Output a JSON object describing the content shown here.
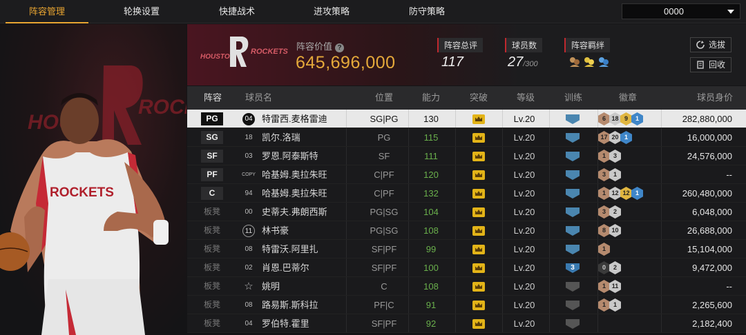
{
  "nav": {
    "tabs": [
      "阵容管理",
      "轮换设置",
      "快捷战术",
      "进攻策略",
      "防守策略"
    ],
    "active_tab": 0,
    "currency_value": "0000"
  },
  "team": {
    "logo_text": "HOUSTON ROCKETS",
    "value_label": "阵容价值",
    "value": "645,696,000",
    "overall_label": "阵容总评",
    "overall": "117",
    "players_label": "球员数",
    "players_count": "27",
    "players_max": "/300",
    "bonds_label": "阵容羁绊",
    "btn_select": "选拔",
    "btn_recycle": "回收"
  },
  "player_art": {
    "jersey_text": "ROCKETS",
    "backdrop_text": "HOUSTON ROCKETS"
  },
  "table": {
    "headers": {
      "slot": "阵容",
      "name": "球员名",
      "position": "位置",
      "ability": "能力",
      "breakthrough": "突破",
      "level": "等级",
      "training": "训练",
      "badges": "徽章",
      "salary": "球员身价"
    },
    "rows": [
      {
        "slot": "PG",
        "starter": true,
        "num": "04",
        "numStyle": "disk",
        "name": "特雷西.麦格雷迪",
        "position": "SG|PG",
        "ability": "130",
        "level": "Lv.20",
        "training": "blue",
        "badges": [
          {
            "t": "b",
            "v": "6"
          },
          {
            "t": "s",
            "v": "18"
          },
          {
            "t": "g",
            "v": "9"
          },
          {
            "t": "h",
            "v": "1"
          }
        ],
        "salary": "282,880,000",
        "selected": true
      },
      {
        "slot": "SG",
        "starter": true,
        "num": "18",
        "numStyle": "",
        "name": "凯尔.洛瑞",
        "position": "PG",
        "ability": "115",
        "level": "Lv.20",
        "training": "blue",
        "badges": [
          {
            "t": "b",
            "v": "17"
          },
          {
            "t": "s",
            "v": "20"
          },
          {
            "t": "h",
            "v": "1"
          }
        ],
        "salary": "16,000,000"
      },
      {
        "slot": "SF",
        "starter": true,
        "num": "03",
        "numStyle": "",
        "name": "罗恩.阿泰斯特",
        "position": "SF",
        "ability": "111",
        "level": "Lv.20",
        "training": "blue",
        "badges": [
          {
            "t": "b",
            "v": "1"
          },
          {
            "t": "s",
            "v": "3"
          }
        ],
        "salary": "24,576,000"
      },
      {
        "slot": "PF",
        "starter": true,
        "num": "COPY",
        "numStyle": "copy",
        "name": "哈基姆.奥拉朱旺",
        "position": "C|PF",
        "ability": "120",
        "level": "Lv.20",
        "training": "blue",
        "badges": [
          {
            "t": "b",
            "v": "3"
          },
          {
            "t": "s",
            "v": "1"
          }
        ],
        "salary": "--"
      },
      {
        "slot": "C",
        "starter": true,
        "num": "94",
        "numStyle": "",
        "name": "哈基姆.奥拉朱旺",
        "position": "C|PF",
        "ability": "132",
        "level": "Lv.20",
        "training": "blue",
        "badges": [
          {
            "t": "b",
            "v": "1"
          },
          {
            "t": "s",
            "v": "12"
          },
          {
            "t": "g",
            "v": "12"
          },
          {
            "t": "h",
            "v": "1"
          }
        ],
        "salary": "260,480,000"
      },
      {
        "slot": "板凳",
        "starter": false,
        "num": "00",
        "numStyle": "",
        "name": "史蒂夫.弗朗西斯",
        "position": "PG|SG",
        "ability": "104",
        "level": "Lv.20",
        "training": "blue",
        "badges": [
          {
            "t": "b",
            "v": "3"
          },
          {
            "t": "s",
            "v": "2"
          }
        ],
        "salary": "6,048,000"
      },
      {
        "slot": "板凳",
        "starter": false,
        "num": "11",
        "numStyle": "ring",
        "name": "林书豪",
        "position": "PG|SG",
        "ability": "108",
        "level": "Lv.20",
        "training": "blue",
        "badges": [
          {
            "t": "b",
            "v": "8"
          },
          {
            "t": "s",
            "v": "10"
          }
        ],
        "salary": "26,688,000"
      },
      {
        "slot": "板凳",
        "starter": false,
        "num": "08",
        "numStyle": "",
        "name": "特雷沃.阿里扎",
        "position": "SF|PF",
        "ability": "99",
        "level": "Lv.20",
        "training": "blue",
        "badges": [
          {
            "t": "b",
            "v": "1"
          }
        ],
        "salary": "15,104,000"
      },
      {
        "slot": "板凳",
        "starter": false,
        "num": "02",
        "numStyle": "",
        "name": "肖恩.巴蒂尔",
        "position": "SF|PF",
        "ability": "100",
        "level": "Lv.20",
        "training": "lv3",
        "badges": [
          {
            "t": "d",
            "v": "0"
          },
          {
            "t": "s",
            "v": "2"
          }
        ],
        "salary": "9,472,000"
      },
      {
        "slot": "板凳",
        "starter": false,
        "num": "star",
        "numStyle": "star",
        "name": "姚明",
        "position": "C",
        "ability": "108",
        "level": "Lv.20",
        "training": "grey",
        "badges": [
          {
            "t": "b",
            "v": "1"
          },
          {
            "t": "s",
            "v": "11"
          }
        ],
        "salary": "--"
      },
      {
        "slot": "板凳",
        "starter": false,
        "num": "08",
        "numStyle": "",
        "name": "路易斯.斯科拉",
        "position": "PF|C",
        "ability": "91",
        "level": "Lv.20",
        "training": "grey",
        "badges": [
          {
            "t": "b",
            "v": "1"
          },
          {
            "t": "s",
            "v": "1"
          }
        ],
        "salary": "2,265,600"
      },
      {
        "slot": "板凳",
        "starter": false,
        "num": "04",
        "numStyle": "",
        "name": "罗伯特.霍里",
        "position": "SF|PF",
        "ability": "92",
        "level": "Lv.20",
        "training": "grey",
        "badges": [],
        "salary": "2,182,400"
      }
    ]
  }
}
